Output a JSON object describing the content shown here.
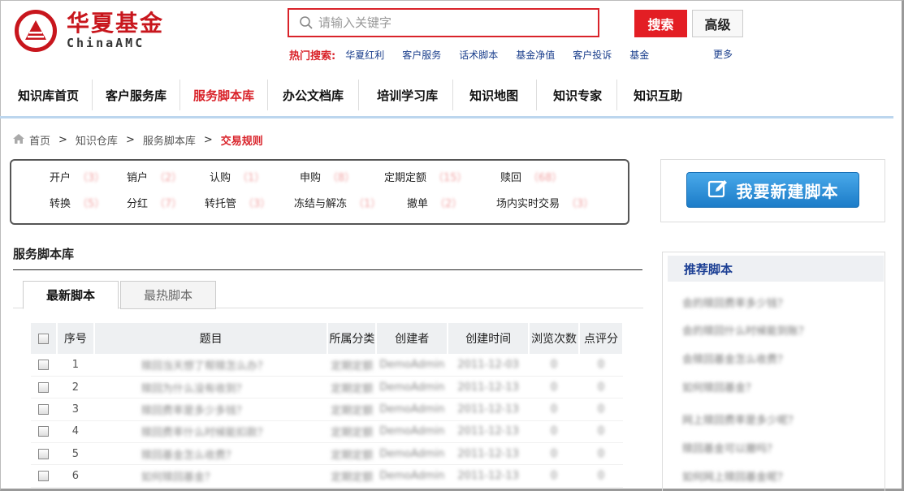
{
  "logo": {
    "cn": "华夏基金",
    "en": "ChinaAMC"
  },
  "search": {
    "placeholder": "请输入关键字",
    "button": "搜索",
    "advanced": "高级"
  },
  "hot": {
    "label": "热门搜索:",
    "terms": [
      "华夏红利",
      "客户服务",
      "话术脚本",
      "基金净值",
      "客户投诉",
      "基金"
    ],
    "more": "更多"
  },
  "nav": [
    "知识库首页",
    "客户服务库",
    "服务脚本库",
    "办公文档库",
    "培训学习库",
    "知识地图",
    "知识专家",
    "知识互助"
  ],
  "breadcrumb": {
    "home": "首页",
    "sep": ">",
    "items": [
      "知识仓库",
      "服务脚本库"
    ],
    "current": "交易规则"
  },
  "categories": [
    {
      "name": "开户",
      "count": "（3）"
    },
    {
      "name": "销户",
      "count": "（2）"
    },
    {
      "name": "认购",
      "count": "（1）"
    },
    {
      "name": "申购",
      "count": "（8）"
    },
    {
      "name": "定期定额",
      "count": "（15）"
    },
    {
      "name": "赎回",
      "count": "（68）"
    },
    {
      "name": "转换",
      "count": "（5）"
    },
    {
      "name": "分红",
      "count": "（7）"
    },
    {
      "name": "转托管",
      "count": "（3）"
    },
    {
      "name": "冻结与解冻",
      "count": "（1）"
    },
    {
      "name": "撤单",
      "count": "（2）"
    },
    {
      "name": "场内实时交易",
      "count": "（3）"
    }
  ],
  "new_script": "我要新建脚本",
  "section_title": "服务脚本库",
  "tabs": [
    "最新脚本",
    "最热脚本"
  ],
  "table": {
    "headers": [
      "序号",
      "题目",
      "所属分类",
      "创建者",
      "创建时间",
      "浏览次数",
      "点评分"
    ],
    "rows": [
      [
        "1",
        "赎回当天想了帮赎怎么办？",
        "定期定额",
        "DemoAdmin",
        "2011-12-03",
        "0",
        "0"
      ],
      [
        "2",
        "赎回为什么没有收到？",
        "定期定额",
        "DemoAdmin",
        "2011-12-13",
        "0",
        "0"
      ],
      [
        "3",
        "赎回费率是多少多钱？",
        "定期定额",
        "DemoAdmin",
        "2011-12-13",
        "0",
        "0"
      ],
      [
        "4",
        "赎回费率什么时候能扣款？",
        "定期定额",
        "DemoAdmin",
        "2011-12-13",
        "0",
        "0"
      ],
      [
        "5",
        "赎回基金怎么收费？",
        "定期定额",
        "DemoAdmin",
        "2011-12-13",
        "0",
        "0"
      ],
      [
        "6",
        "如何赎回基金？",
        "定期定额",
        "DemoAdmin",
        "2011-12-13",
        "0",
        "0"
      ]
    ]
  },
  "sidebar": {
    "title": "推荐脚本",
    "items": [
      "会的赎回费率多少钱？",
      "会的赎回什么时候能到账？",
      "会赎回基金怎么收费？",
      "如何赎回基金？",
      "网上赎回费率是多少呢？",
      "赎回基金可以撤吗？",
      "如何网上赎回基金呢？"
    ]
  },
  "colors": {
    "accent": "#d9232a",
    "nav_active": "#d9232a",
    "link": "#1a3e8c",
    "button_blue": "#1c7cc8"
  }
}
